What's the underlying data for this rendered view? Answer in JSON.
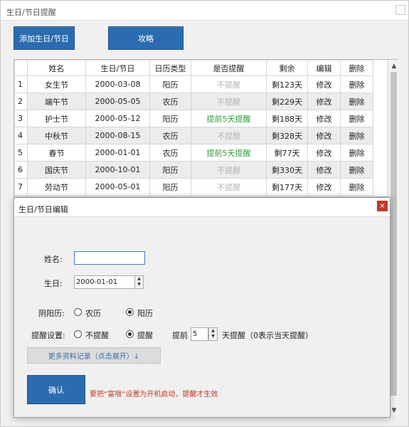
{
  "window": {
    "title": "生日/节日提醒"
  },
  "toolbar": {
    "add_label": "添加生日/节日",
    "guide_label": "攻略"
  },
  "grid": {
    "columns": [
      "姓名",
      "生日/节日",
      "日历类型",
      "是否提醒",
      "剩余",
      "编辑",
      "删除"
    ],
    "rows": [
      {
        "num": "1",
        "name": "女生节",
        "date": "2000-03-08",
        "calendar": "阳历",
        "remind": "不提醒",
        "remind_on": false,
        "remaining": "剩123天",
        "edit": "修改",
        "delete": "删除"
      },
      {
        "num": "2",
        "name": "端午节",
        "date": "2000-05-05",
        "calendar": "农历",
        "remind": "不提醒",
        "remind_on": false,
        "remaining": "剩229天",
        "edit": "修改",
        "delete": "删除"
      },
      {
        "num": "3",
        "name": "护士节",
        "date": "2000-05-12",
        "calendar": "阳历",
        "remind": "提前5天提醒",
        "remind_on": true,
        "remaining": "剩188天",
        "edit": "修改",
        "delete": "删除"
      },
      {
        "num": "4",
        "name": "中秋节",
        "date": "2000-08-15",
        "calendar": "农历",
        "remind": "不提醒",
        "remind_on": false,
        "remaining": "剩328天",
        "edit": "修改",
        "delete": "删除"
      },
      {
        "num": "5",
        "name": "春节",
        "date": "2000-01-01",
        "calendar": "农历",
        "remind": "提前5天提醒",
        "remind_on": true,
        "remaining": "剩77天",
        "edit": "修改",
        "delete": "删除"
      },
      {
        "num": "6",
        "name": "国庆节",
        "date": "2000-10-01",
        "calendar": "阳历",
        "remind": "不提醒",
        "remind_on": false,
        "remaining": "剩330天",
        "edit": "修改",
        "delete": "删除"
      },
      {
        "num": "7",
        "name": "劳动节",
        "date": "2000-05-01",
        "calendar": "阳历",
        "remind": "不提醒",
        "remind_on": false,
        "remaining": "剩177天",
        "edit": "修改",
        "delete": "删除"
      }
    ]
  },
  "dialog": {
    "title": "生日/节日编辑",
    "close_glyph": "×",
    "name_label": "姓名:",
    "name_value": "",
    "birthday_label": "生日:",
    "birthday_value": "2000-01-01",
    "calendar_label": "阴阳历:",
    "calendar_options": [
      "农历",
      "阳历"
    ],
    "calendar_selected": "阳历",
    "remind_label": "提醒设置:",
    "remind_options": [
      "不提醒",
      "提醒"
    ],
    "remind_selected": "提醒",
    "advance_prefix": "提前",
    "advance_days": "5",
    "advance_suffix": "天提醒（0表示当天提醒）",
    "expand_label": "更多资料记录（点击展开）↓",
    "confirm_label": "确认",
    "note": "要把“富哦”设置为开机启动，提醒才生效"
  },
  "colors": {
    "accent": "#2b6cb0",
    "remind_on": "#2e9e3a",
    "remind_off": "#b5b5b5",
    "warning": "#c0392b"
  }
}
